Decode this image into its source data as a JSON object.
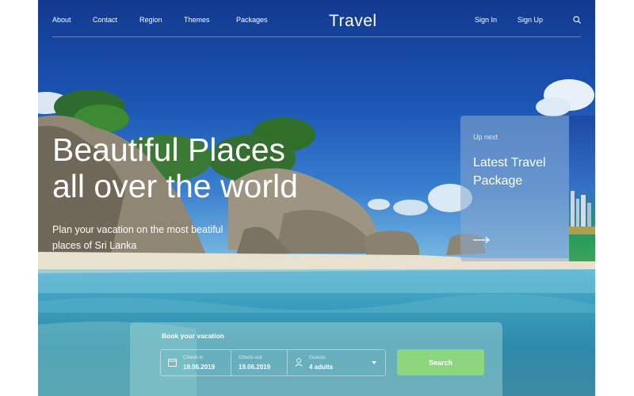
{
  "nav": {
    "left_links": [
      "About",
      "Contact",
      "Region",
      "Themes",
      "Packages"
    ],
    "brand": "Travel",
    "sign_in": "Sign In",
    "sign_up": "Sign Up"
  },
  "hero": {
    "headline_line1": "Beautiful Places",
    "headline_line2": "all over the world",
    "subline": "Plan your vacation on the most beatiful places of Sri Lanka"
  },
  "up_next": {
    "label": "Up next",
    "title": "Latest Travel Package"
  },
  "booking": {
    "title": "Book your vacation",
    "check_in_label": "Check-in",
    "check_in_value": "19.06.2019",
    "check_out_label": "Check-out",
    "check_out_value": "19.06.2019",
    "guests_label": "Guests",
    "guests_value": "4 adults",
    "search_label": "Search"
  },
  "colors": {
    "accent_green": "#8ed67e",
    "sky_blue": "#1b55b5",
    "text": "#ffffff"
  }
}
